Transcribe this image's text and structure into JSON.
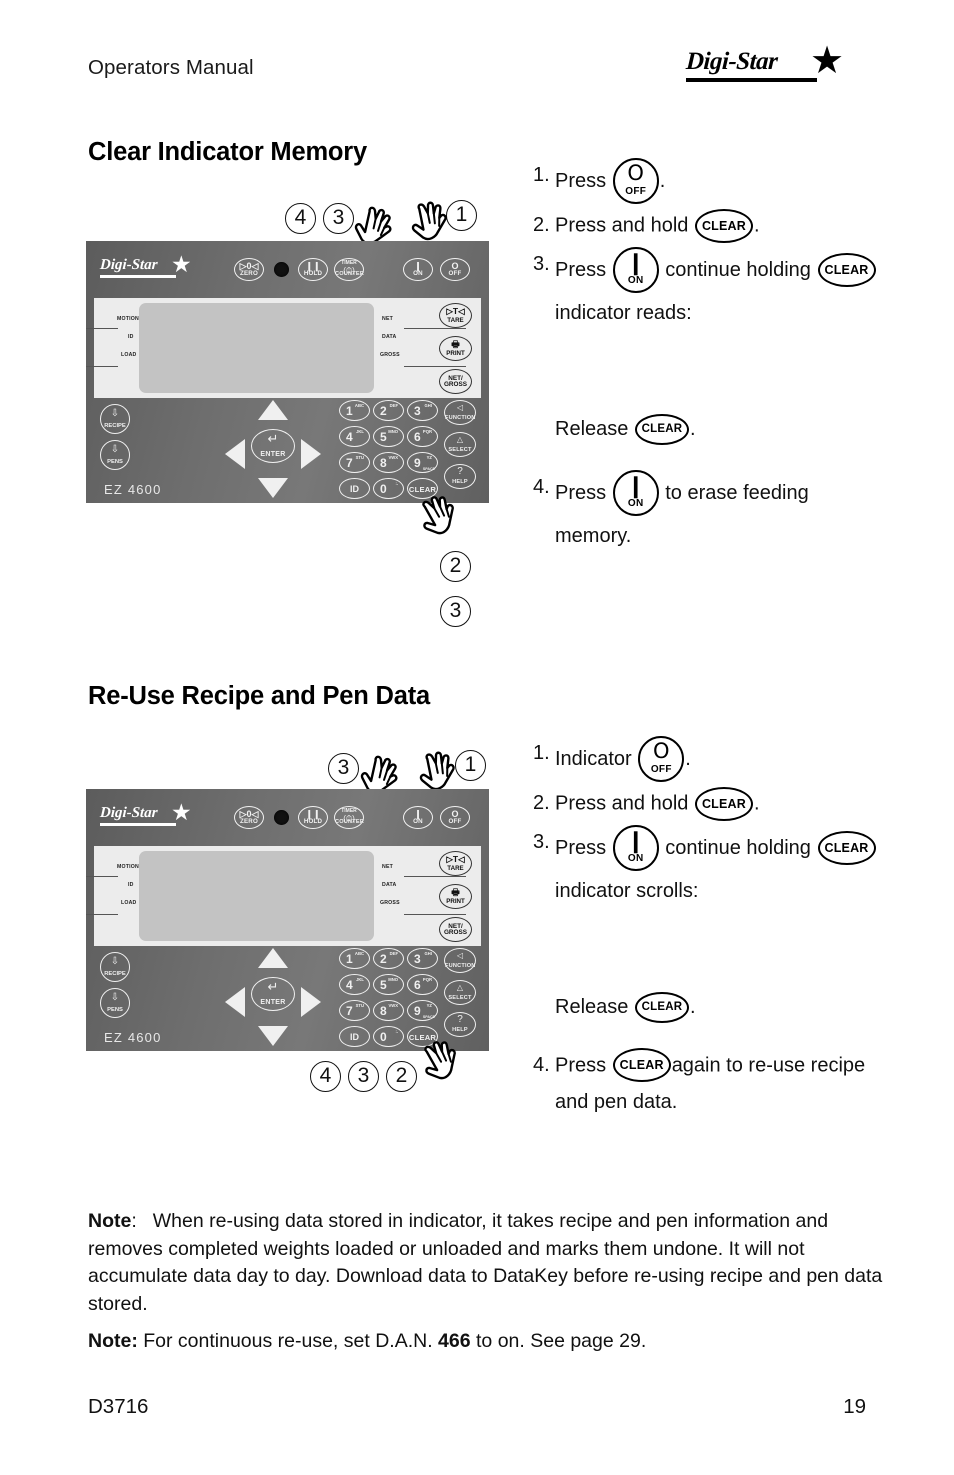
{
  "header": {
    "title": "Operators Manual",
    "logo_text": "Digi-Star",
    "logo_star": "★"
  },
  "sections": [
    {
      "id": "clear-indicator-memory",
      "heading": "Clear Indicator Memory",
      "callouts_top": [
        "4",
        "3",
        "1"
      ],
      "callouts_bottom": [
        "2",
        "3"
      ],
      "steps": [
        {
          "num": "1.",
          "pre": "Press",
          "key": "OFF",
          "post": "."
        },
        {
          "num": "2.",
          "pre": "Press and hold",
          "key": "CLEAR",
          "post": "."
        },
        {
          "num": "3.",
          "pre": "Press",
          "key": "ON",
          "mid": "continue holding",
          "key2": "CLEAR",
          "cont": "indicator reads:"
        },
        {
          "release_label": "Release",
          "release_key": "CLEAR",
          "release_post": "."
        },
        {
          "num": "4.",
          "pre": "Press",
          "key": "ON",
          "post": "to erase feeding",
          "cont": "memory."
        }
      ]
    },
    {
      "id": "re-use-recipe-and-pen-data",
      "heading": "Re-Use Recipe and Pen Data",
      "callouts_top": [
        "3",
        "1"
      ],
      "callouts_bottom": [
        "4",
        "3",
        "2"
      ],
      "steps": [
        {
          "num": "1.",
          "pre": "Indicator",
          "key": "OFF",
          "post": "."
        },
        {
          "num": "2.",
          "pre": "Press and hold",
          "key": "CLEAR",
          "post": "."
        },
        {
          "num": "3.",
          "pre": "Press",
          "key": "ON",
          "mid": "continue holding",
          "key2": "CLEAR",
          "cont": "indicator scrolls:"
        },
        {
          "release_label": "Release",
          "release_key": "CLEAR",
          "release_post": "."
        },
        {
          "num": "4.",
          "pre": "Press",
          "key": "CLEAR",
          "post": "again to re-use recipe",
          "cont": "and pen data."
        }
      ]
    }
  ],
  "device": {
    "brand": "Digi-Star",
    "brand_star": "★",
    "model": "EZ 4600",
    "top_keys": [
      {
        "name": "zero",
        "sym": "▷0◁",
        "label": "ZERO"
      },
      {
        "name": "hold",
        "sym": "❙❙",
        "label": "HOLD"
      },
      {
        "name": "timer-counter",
        "sym": "(⏱)",
        "label_top": "TIMER",
        "label": "COUNTER"
      },
      {
        "name": "on",
        "sym": "❙",
        "label": "ON"
      },
      {
        "name": "off",
        "sym": "O",
        "label": "OFF"
      }
    ],
    "display_labels_left": [
      "MOTION",
      "ID",
      "LOAD"
    ],
    "display_labels_right": [
      "NET",
      "DATA",
      "GROSS"
    ],
    "side_keys": [
      {
        "name": "tare",
        "sym": "▷T◁",
        "label": "TARE"
      },
      {
        "name": "print",
        "sym": "🖶",
        "label": "PRINT"
      },
      {
        "name": "net-gross",
        "label_top": "NET/",
        "label": "GROSS"
      }
    ],
    "left_keys": [
      {
        "name": "recipe",
        "label": "RECIPE"
      },
      {
        "name": "pens",
        "label": "PENS"
      }
    ],
    "dpad": {
      "enter_label": "ENTER",
      "enter_sym": "↵"
    },
    "numpad": [
      {
        "digit": "1",
        "letters": "ABC"
      },
      {
        "digit": "2",
        "letters": "DEF"
      },
      {
        "digit": "3",
        "letters": "GHI"
      },
      {
        "digit": "4",
        "letters": "JKL"
      },
      {
        "digit": "5",
        "letters": "MNO"
      },
      {
        "digit": "6",
        "letters": "PQR"
      },
      {
        "digit": "7",
        "letters": "STU"
      },
      {
        "digit": "8",
        "letters": "VWX"
      },
      {
        "digit": "9",
        "letters": "YZ",
        "extra": "SPACE"
      },
      {
        "word": "ID"
      },
      {
        "digit": "0",
        "letters": ":."
      },
      {
        "word": "CLEAR"
      }
    ],
    "function_keys": [
      {
        "name": "function",
        "sym": "◁",
        "label": "FUNCTION"
      },
      {
        "name": "select",
        "sym": "△",
        "label": "SELECT"
      },
      {
        "name": "help",
        "sym": "?",
        "label": "HELP"
      }
    ]
  },
  "notes": [
    {
      "label": "Note",
      "colon": ":",
      "text": "When re-using data stored in indicator, it takes recipe and pen information and removes completed weights loaded or unloaded and marks them undone. It will not accumulate data day to day. Download data to DataKey before re-using recipe and pen data stored."
    },
    {
      "label": "Note:",
      "text_before": "For continuous re-use, set D.A.N.",
      "bold_value": "466",
      "text_after": "to on. See page 29."
    }
  ],
  "footer": {
    "doc_id": "D3716",
    "page_number": "19"
  }
}
